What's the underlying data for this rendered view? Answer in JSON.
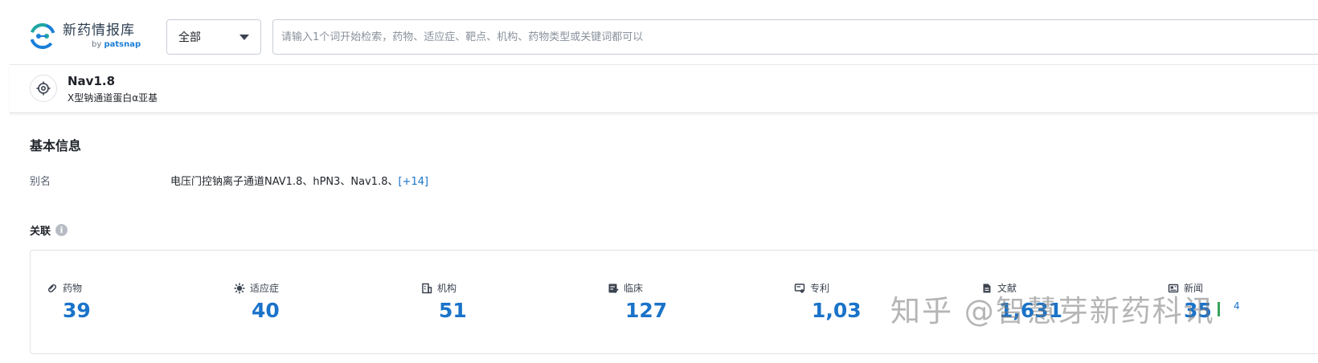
{
  "brand": {
    "name": "新药情报库",
    "by_prefix": "by",
    "by_name": "patsnap"
  },
  "search": {
    "scope_value": "全部",
    "placeholder": "请输入1个词开始检索，药物、适应症、靶点、机构、药物类型或关键词都可以"
  },
  "target": {
    "name": "Nav1.8",
    "subtitle": "X型钠通道蛋白α亚基"
  },
  "basic_info": {
    "title": "基本信息",
    "alias_label": "别名",
    "alias_value": "电压门控钠离子通道NAV1.8、hPN3、Nav1.8、",
    "alias_more": "[+14]"
  },
  "relations": {
    "title": "关联",
    "info_icon": "i",
    "items": [
      {
        "label": "药物",
        "value": "39",
        "icon": "pill-icon"
      },
      {
        "label": "适应症",
        "value": "40",
        "icon": "virus-icon"
      },
      {
        "label": "机构",
        "value": "51",
        "icon": "building-icon"
      },
      {
        "label": "临床",
        "value": "127",
        "icon": "clinical-icon"
      },
      {
        "label": "专利",
        "value": "1,03",
        "icon": "patent-icon"
      },
      {
        "label": "文献",
        "value": "1,631",
        "icon": "document-icon"
      },
      {
        "label": "新闻",
        "value": "35",
        "icon": "news-icon",
        "extra": "4"
      }
    ]
  },
  "watermark": "知乎 @智慧芽新药科讯",
  "colors": {
    "accent": "#1a73c9",
    "logo_teal": "#20a8a0",
    "logo_blue": "#1a7fd8"
  }
}
